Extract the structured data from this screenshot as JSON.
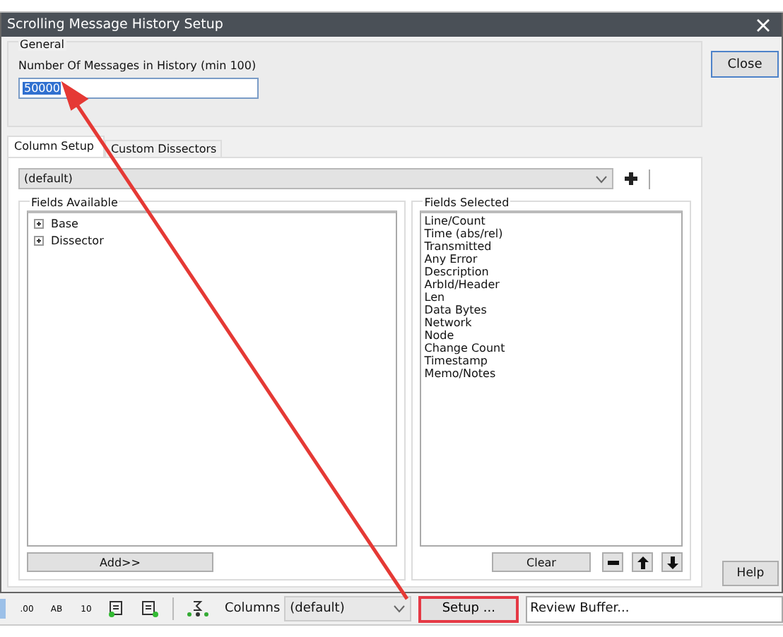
{
  "dialog": {
    "title": "Scrolling Message History Setup",
    "general": {
      "title": "General",
      "label": "Number Of Messages in History (min 100)",
      "value": "50000",
      "value_selected": true
    },
    "tabs": [
      {
        "label": "Column Setup",
        "selected": true
      },
      {
        "label": "Custom Dissectors",
        "selected": false
      }
    ],
    "preset": {
      "value": "(default)"
    },
    "fields_available": {
      "title": "Fields Available",
      "items": [
        {
          "label": "Base",
          "expanded": false
        },
        {
          "label": "Dissector",
          "expanded": false
        }
      ],
      "add_button": "Add>>"
    },
    "fields_selected": {
      "title": "Fields Selected",
      "items": [
        "Line/Count",
        "Time (abs/rel)",
        "Transmitted",
        "Any Error",
        "Description",
        "ArbId/Header",
        "Len",
        "Data Bytes",
        "Network",
        "Node",
        "Change Count",
        "Timestamp",
        "Memo/Notes"
      ],
      "clear_button": "Clear"
    },
    "close_button": "Close",
    "help_button": "Help"
  },
  "toolbar": {
    "format_buttons": [
      ".00",
      "AB",
      "10"
    ],
    "columns_label": "Columns",
    "columns_value": "(default)",
    "setup_button": "Setup ...",
    "setup_highlighted": true,
    "buffer_value": "Review Buffer..."
  }
}
